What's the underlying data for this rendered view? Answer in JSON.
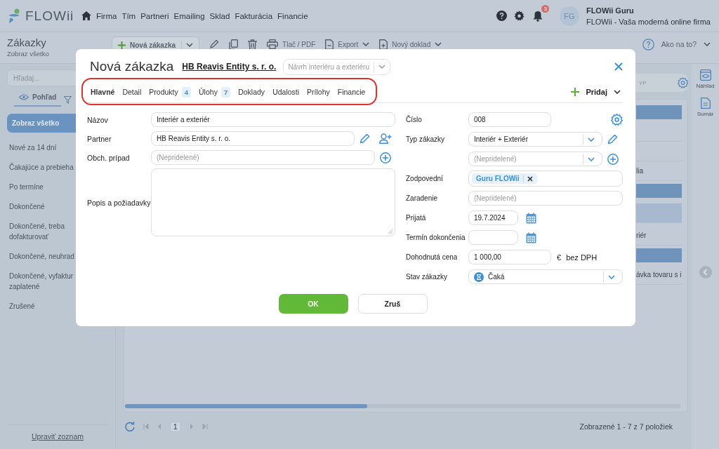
{
  "header": {
    "logo": "FLOWii",
    "nav": [
      "Firma",
      "Tím",
      "Partneri",
      "Emailing",
      "Sklad",
      "Fakturácia",
      "Financie"
    ],
    "notifications": "3",
    "avatar": "FG",
    "user_name": "FLOWii Guru",
    "company": "FLOWii - Vaša moderná online firma"
  },
  "toolbar": {
    "title": "Zákazky",
    "subtitle": "Zobraz všetko",
    "new_button": "Nová zákazka",
    "print": "Tlač / PDF",
    "export": "Export",
    "new_document": "Nový doklad",
    "help": "Ako na to?"
  },
  "sidebar": {
    "search_placeholder": "Hľadaj...",
    "tabs": [
      {
        "label": "Pohľad",
        "selected": true
      }
    ],
    "items": [
      {
        "label": "Zobraz všetko",
        "selected": true
      },
      {
        "label": "Nové za 14 dní",
        "selected": false
      },
      {
        "label": "Čakajúce a prebieha",
        "selected": false
      },
      {
        "label": "Po termíne",
        "selected": false
      },
      {
        "label": "Dokončené",
        "selected": false
      },
      {
        "label": "Dokončené, treba dofakturovať",
        "selected": false
      },
      {
        "label": "Dokončené, neuhrad",
        "selected": false
      },
      {
        "label": "Dokončené, vyfaktur zaplatené",
        "selected": false
      },
      {
        "label": "Zrušené",
        "selected": false
      }
    ],
    "footer_link": "Upraviť zoznam"
  },
  "table": {
    "column_header": "YP",
    "rows": [
      {
        "kind": "group",
        "selected": false
      },
      {
        "kind": "row",
        "selected": false
      },
      {
        "kind": "row",
        "selected": false
      },
      {
        "kind": "row",
        "text": "lia",
        "selected": false
      },
      {
        "kind": "group",
        "selected": false
      },
      {
        "kind": "row",
        "selected": true
      },
      {
        "kind": "row",
        "text": "riér",
        "selected": false
      },
      {
        "kind": "group",
        "selected": false
      },
      {
        "kind": "row",
        "text": "ávka tovaru s i",
        "selected": false
      }
    ]
  },
  "pager": {
    "page": "1",
    "summary": "Zobrazené 1 - 7 z 7 položiek"
  },
  "side_panel": [
    "Náhľad",
    "Sumár"
  ],
  "modal": {
    "title": "Nová zákazka",
    "partner_link": "HB Reavis Entity s. r. o.",
    "template_placeholder": "Návrh interiéru a exteriéru",
    "tabs": [
      {
        "label": "Hlavné",
        "selected": true
      },
      {
        "label": "Detail",
        "selected": false
      },
      {
        "label": "Produkty",
        "count": "4",
        "selected": false
      },
      {
        "label": "Úlohy",
        "count": "7",
        "selected": false
      },
      {
        "label": "Doklady",
        "selected": false
      },
      {
        "label": "Udalosti",
        "selected": false
      },
      {
        "label": "Prílohy",
        "selected": false
      },
      {
        "label": "Financie",
        "selected": false
      }
    ],
    "add_button": "Pridaj",
    "left_fields": [
      {
        "kind": "text",
        "label": "Názov",
        "value": "Interiér a exteriér"
      },
      {
        "kind": "text",
        "label": "Partner",
        "value": "HB Reavis Entity s. r. o.",
        "actions": [
          {
            "kind": "edit"
          },
          {
            "kind": "add-person"
          }
        ]
      },
      {
        "kind": "text",
        "label": "Obch. prípad",
        "placeholder": "(Nepridelené)",
        "actions": [
          {
            "kind": "add"
          }
        ]
      },
      {
        "kind": "textarea",
        "label": "Popis a požiadavky"
      }
    ],
    "right_fields": [
      {
        "kind": "number",
        "label": "Číslo",
        "value": "008",
        "actions": [
          {
            "kind": "settings"
          }
        ]
      },
      {
        "kind": "select",
        "label": "Typ zákazky",
        "value": "Interiér + Exteriér",
        "actions": [
          {
            "kind": "edit"
          }
        ]
      },
      {
        "kind": "select",
        "placeholder": "(Nepridelené)",
        "actions": [
          {
            "kind": "add"
          }
        ]
      },
      {
        "kind": "tags",
        "label": "Zodpovední",
        "tags": [
          "Guru FLOWii"
        ]
      },
      {
        "kind": "text",
        "label": "Zaradenie",
        "placeholder": "(Nepridelené)"
      },
      {
        "kind": "date",
        "label": "Prijatá",
        "value": "19.7.2024",
        "actions": [
          {
            "kind": "calendar"
          }
        ]
      },
      {
        "kind": "date",
        "label": "Termín dokončenia",
        "actions": [
          {
            "kind": "calendar"
          }
        ]
      },
      {
        "kind": "money",
        "label": "Dohodnutá cena",
        "value": "1 000,00",
        "currency": "€",
        "note": "bez DPH"
      },
      {
        "kind": "status",
        "label": "Stav zákazky",
        "value": "Čaká"
      }
    ],
    "buttons": [
      {
        "kind": "primary",
        "label": "OK"
      },
      {
        "kind": "secondary",
        "label": "Zruš"
      }
    ]
  }
}
